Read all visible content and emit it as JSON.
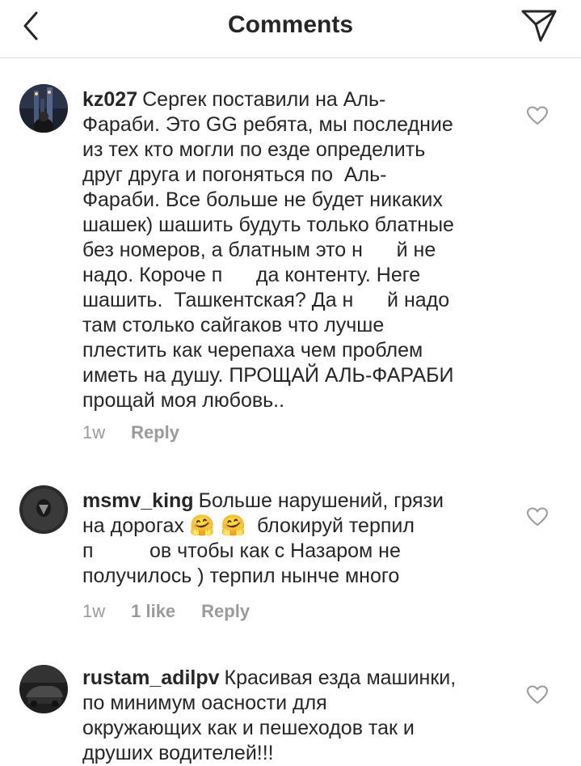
{
  "header": {
    "title": "Comments",
    "back_icon": "chevron-left-icon",
    "send_icon": "paper-plane-icon"
  },
  "comments": [
    {
      "username": "kz027",
      "text": "Сергек поставили на Аль-\nФараби. Это GG ребята, мы последние\nиз тех кто могли по езде определить\nдруг друга и погоняться по  Аль-\nФараби. Все больше не будет никаких\nшашек) шашить будуть только блатные\nбез номеров, а блатным это н      й не\nнадо. Короче п      да контенту. Неге\nшашить.  Ташкентская? Да н      й надо\nтам столько сайгаков что лучше\nплестить как черепаха чем проблем\nиметь на душу. ПРОЩАЙ АЛЬ-ФАРАБИ\nпрощай моя любовь..",
      "time": "1w",
      "likes": "",
      "reply_label": "Reply"
    },
    {
      "username": "msmv_king",
      "text": "Больше нарушений, грязи\nна дорогах 🤗 🤗  блокируй терпил\nп          ов чтобы как с Назаром не\nполучилось ) терпил нынче много",
      "time": "1w",
      "likes": "1 like",
      "reply_label": "Reply"
    },
    {
      "username": "rustam_adilpv",
      "text": "Красивая езда машинки,\nпо минимум оасности для\nокружающих как и пешеходов так и\nдруших водителей!!!",
      "time": "",
      "likes": "",
      "reply_label": ""
    }
  ],
  "colors": {
    "text": "#262626",
    "meta": "#9a9a9a",
    "divider": "#dbdbdb"
  }
}
